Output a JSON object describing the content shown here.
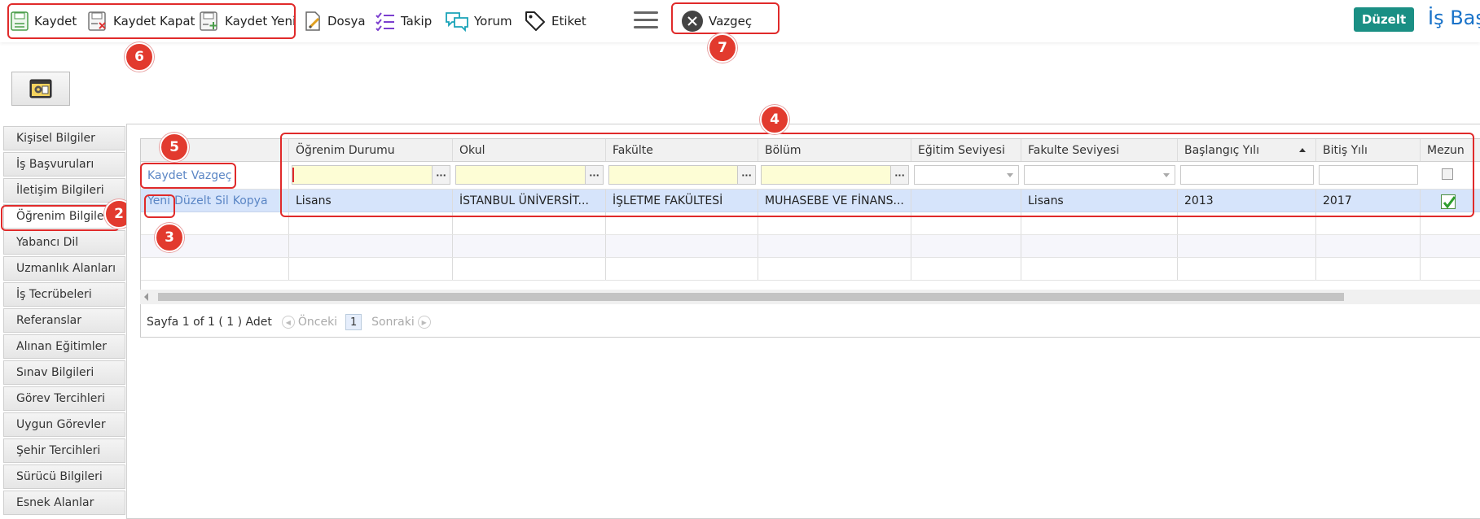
{
  "toolbar": {
    "save": "Kaydet",
    "save_close": "Kaydet Kapat",
    "save_new": "Kaydet Yeni",
    "file": "Dosya",
    "follow": "Takip",
    "comment": "Yorum",
    "tag": "Etiket",
    "cancel": "Vazgeç",
    "edit": "Düzelt",
    "brand": "İş Baş"
  },
  "icons": [
    "save-icon",
    "save-close-icon",
    "save-new-icon",
    "file-icon",
    "checklist-icon",
    "comment-icon",
    "tag-icon",
    "hamburger-icon",
    "close-circle-icon",
    "settings-window-icon"
  ],
  "colors": {
    "accent": "#1a8f84",
    "brand": "#1a73c9",
    "annotation": "#e02a2a",
    "selected_row": "#d6e4fb"
  },
  "badges": [
    "2",
    "3",
    "4",
    "5",
    "6",
    "7"
  ],
  "sidebar": {
    "items": [
      {
        "label": "Kişisel Bilgiler"
      },
      {
        "label": "İş Başvuruları"
      },
      {
        "label": "İletişim Bilgileri"
      },
      {
        "label": "Öğrenim Bilgileri",
        "active": true
      },
      {
        "label": "Yabancı Dil"
      },
      {
        "label": "Uzmanlık Alanları"
      },
      {
        "label": "İş Tecrübeleri"
      },
      {
        "label": "Referanslar"
      },
      {
        "label": "Alınan Eğitimler"
      },
      {
        "label": "Sınav Bilgileri"
      },
      {
        "label": "Görev Tercihleri"
      },
      {
        "label": "Uygun Görevler"
      },
      {
        "label": "Şehir Tercihleri"
      },
      {
        "label": "Sürücü Bilgileri"
      },
      {
        "label": "Esnek Alanlar"
      }
    ]
  },
  "grid": {
    "columns": [
      "Öğrenim Durumu",
      "Okul",
      "Fakülte",
      "Bölüm",
      "Eğitim Seviyesi",
      "Fakulte Seviyesi",
      "Başlangıç Yılı",
      "Bitiş Yılı",
      "Mezun"
    ],
    "filter_actions": {
      "save": "Kaydet",
      "cancel": "Vazgeç"
    },
    "row_actions": {
      "new": "Yeni",
      "edit": "Düzelt",
      "delete": "Sil",
      "copy": "Kopya"
    },
    "rows": [
      {
        "ogrenim_durumu": "Lisans",
        "okul": "İSTANBUL ÜNİVERSİT...",
        "fakulte": "İŞLETME FAKÜLTESİ",
        "bolum": "MUHASEBE VE FİNANS...",
        "egitim_seviyesi": "",
        "fakulte_seviyesi": "Lisans",
        "baslangic_yili": "2013",
        "bitis_yili": "2017",
        "mezun": true
      }
    ]
  },
  "pager": {
    "summary": "Sayfa 1 of 1 ( 1 ) Adet",
    "prev": "Önceki",
    "current": "1",
    "next": "Sonraki"
  }
}
